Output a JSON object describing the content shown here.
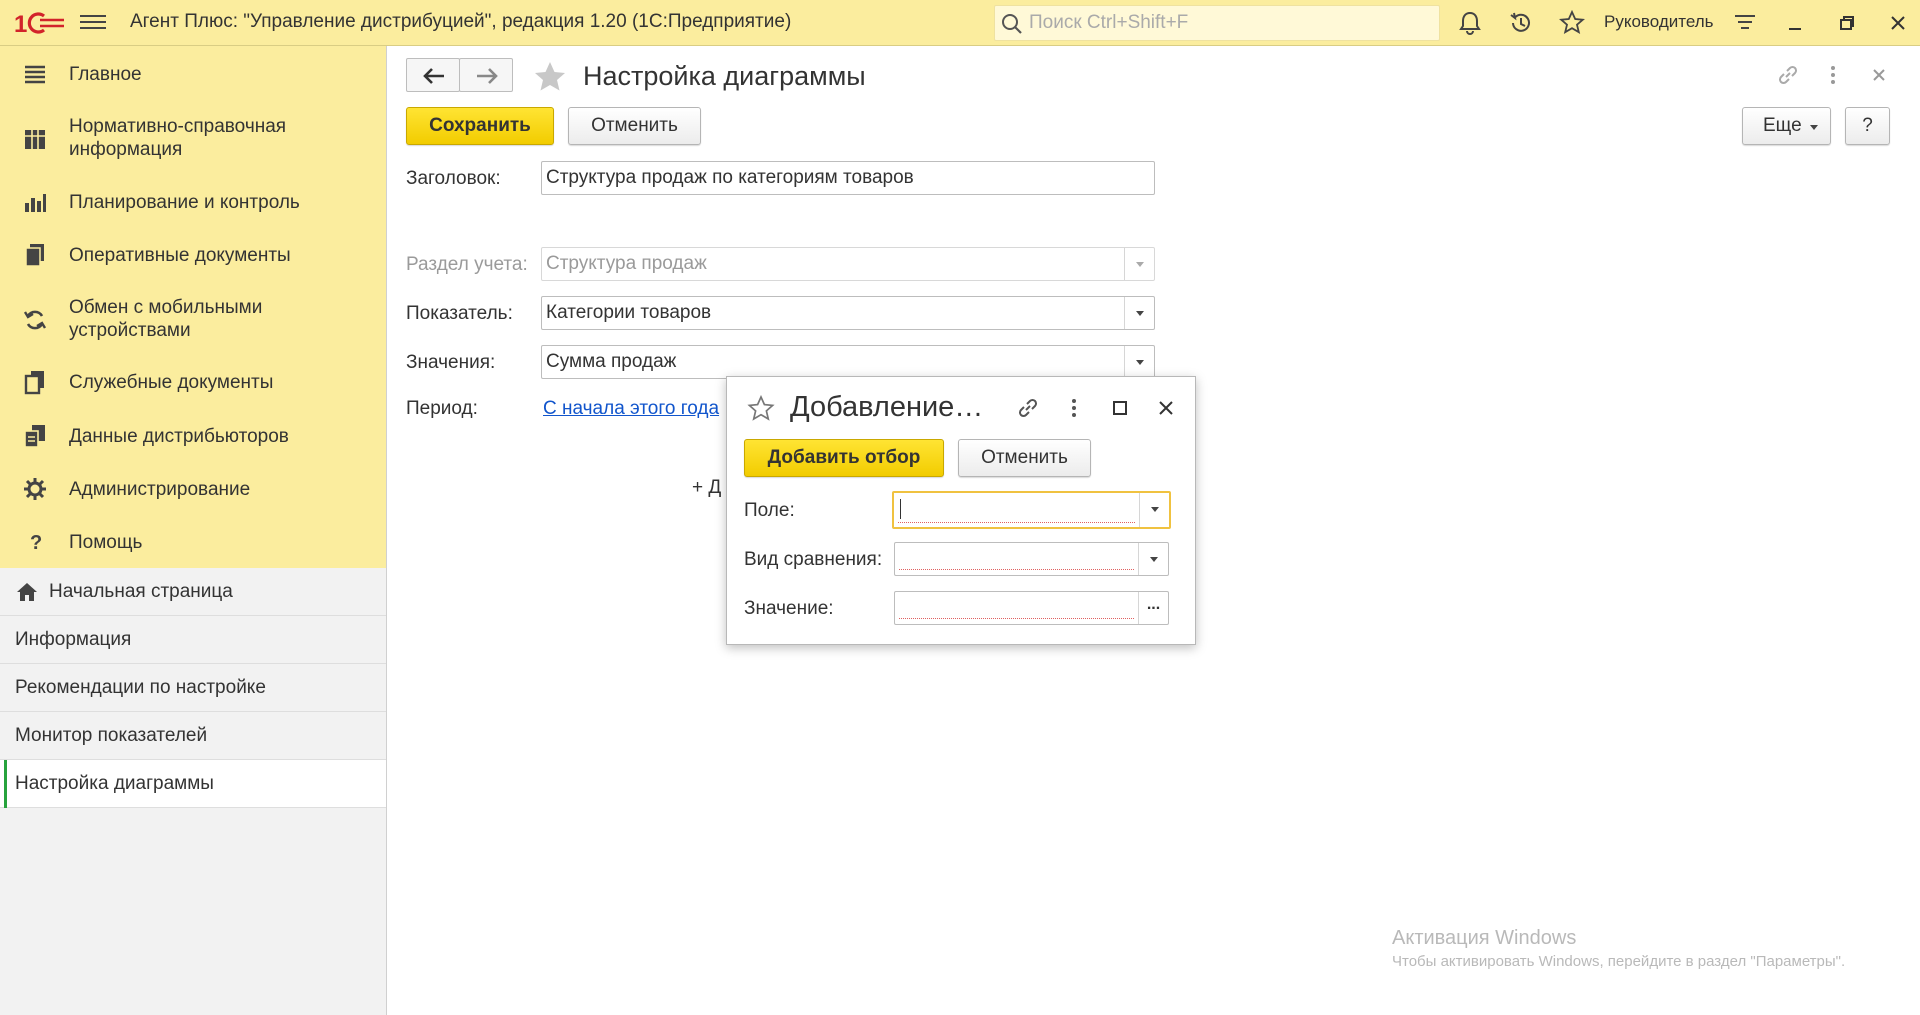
{
  "topbar": {
    "logo": "1С",
    "title": "Агент Плюс: \"Управление дистрибуцией\", редакция 1.20  (1С:Предприятие)",
    "search_placeholder": "Поиск Ctrl+Shift+F",
    "user": "Руководитель",
    "icons": [
      "bell-icon",
      "history-icon",
      "star-icon",
      "settings-icon",
      "minimize-icon",
      "restore-icon",
      "close-icon"
    ]
  },
  "sidebar": {
    "sections": [
      {
        "label": "Главное",
        "icon": "menu-icon"
      },
      {
        "label": "Нормативно-справочная информация",
        "icon": "catalog-icon"
      },
      {
        "label": "Планирование и контроль",
        "icon": "chart-icon"
      },
      {
        "label": "Оперативные документы",
        "icon": "documents-icon"
      },
      {
        "label": "Обмен с мобильными устройствами",
        "icon": "sync-icon"
      },
      {
        "label": "Служебные документы",
        "icon": "service-docs-icon"
      },
      {
        "label": "Данные дистрибьюторов",
        "icon": "distributor-icon"
      },
      {
        "label": "Администрирование",
        "icon": "gear-icon"
      },
      {
        "label": "Помощь",
        "icon": "help-icon"
      }
    ],
    "open_windows": [
      {
        "label": "Начальная страница",
        "home": true
      },
      {
        "label": "Информация"
      },
      {
        "label": "Рекомендации по настройке"
      },
      {
        "label": "Монитор показателей"
      },
      {
        "label": "Настройка диаграммы",
        "active": true
      }
    ]
  },
  "form": {
    "title": "Настройка диаграммы",
    "save_label": "Сохранить",
    "cancel_label": "Отменить",
    "more_label": "Еще",
    "help_label": "?",
    "fields": {
      "title_label": "Заголовок:",
      "title_value": "Структура продаж по категориям товаров",
      "section_label": "Раздел учета:",
      "section_value": "Структура продаж",
      "indicator_label": "Показатель:",
      "indicator_value": "Категории товаров",
      "values_label": "Значения:",
      "values_value": "Сумма продаж",
      "period_label": "Период:",
      "period_value": "С начала этого года"
    },
    "add_text": "+ Д"
  },
  "dialog": {
    "title": "Добавление…",
    "add_label": "Добавить отбор",
    "cancel_label": "Отменить",
    "field_label": "Поле:",
    "field_value": "",
    "compare_label": "Вид сравнения:",
    "compare_value": "",
    "value_label": "Значение:",
    "value_value": "",
    "dots": "..."
  },
  "watermark": {
    "line1": "Активация Windows",
    "line2": "Чтобы активировать Windows, перейдите в раздел \"Параметры\"."
  },
  "colors": {
    "panel_yellow": "#fbed9e",
    "button_yellow": "#f5d200",
    "link_blue": "#1155cc",
    "active_marker": "#27a33d"
  }
}
